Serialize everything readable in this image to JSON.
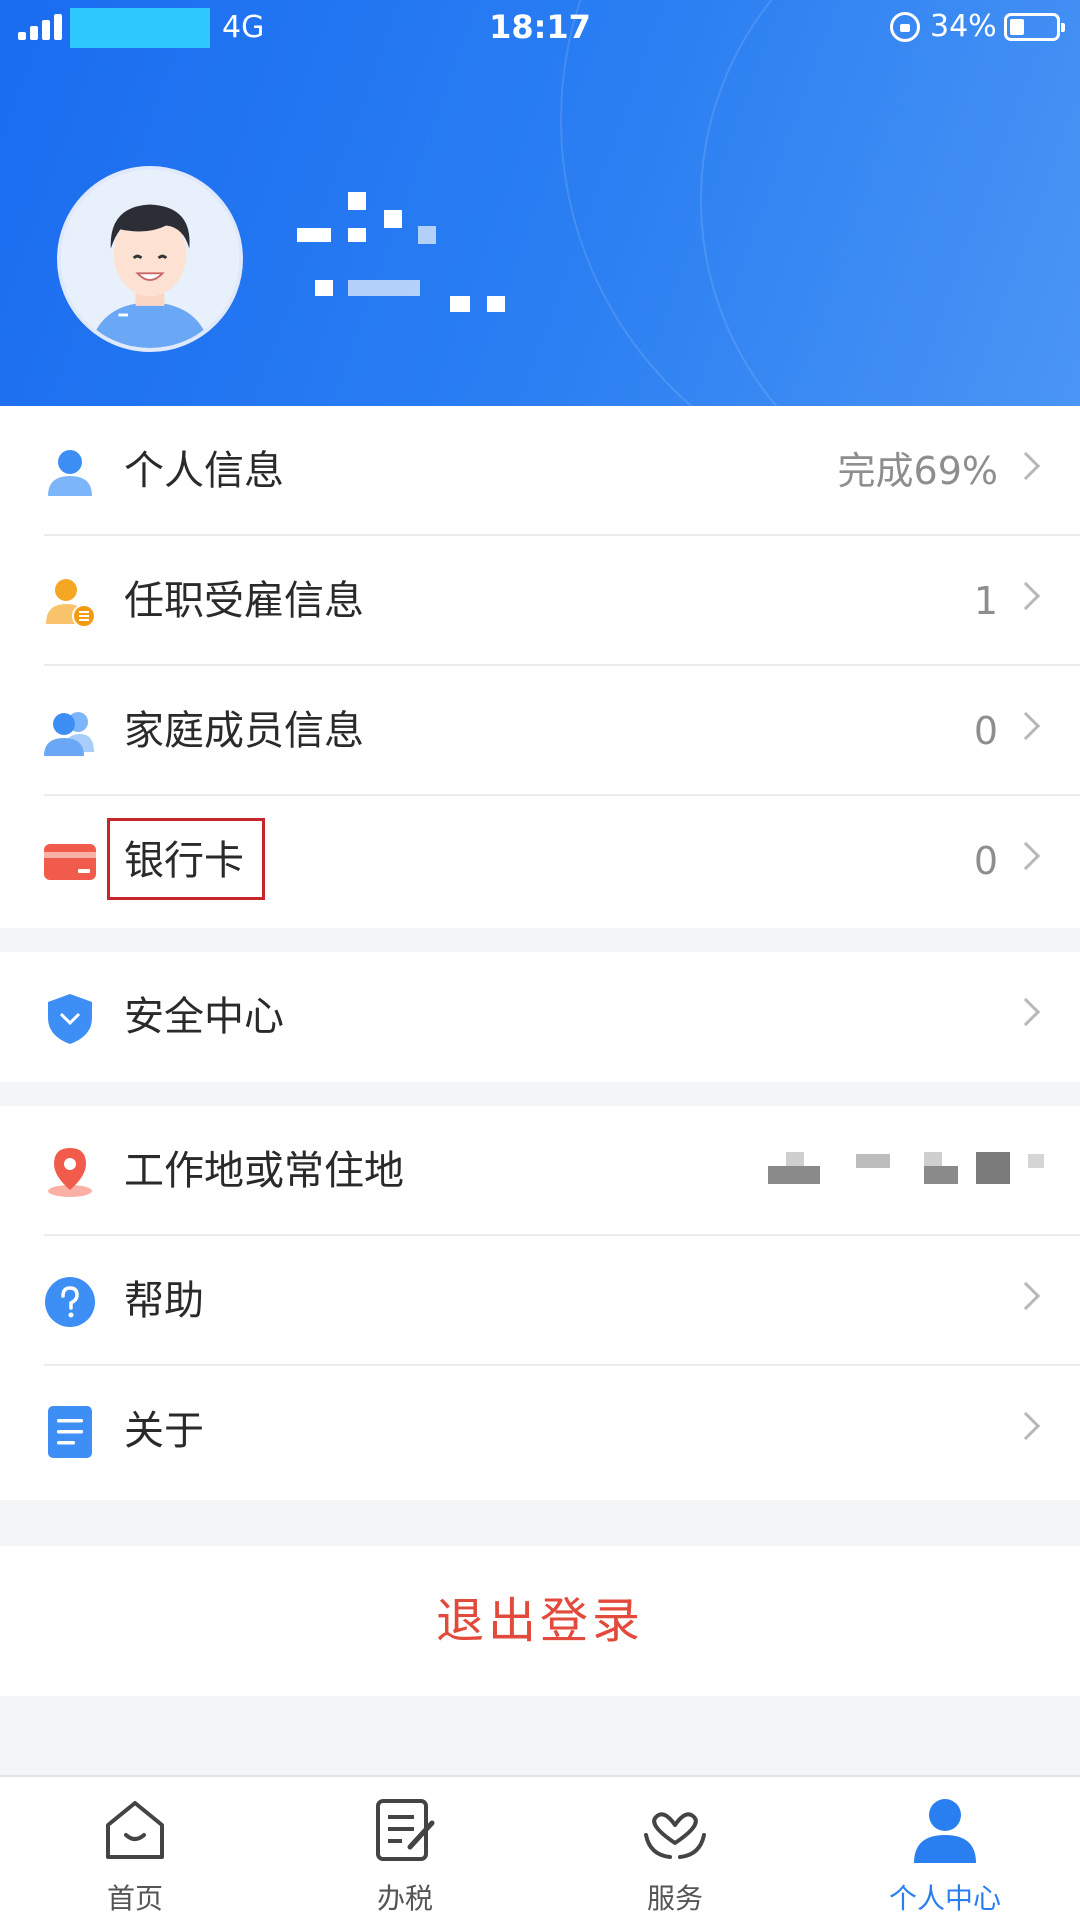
{
  "status_bar": {
    "network": "4G",
    "time": "18:17",
    "battery": "34%",
    "battery_level": 0.34
  },
  "menu_group_1": [
    {
      "key": "personal-info",
      "label": "个人信息",
      "value": "完成69%",
      "icon": "person-icon",
      "color": "#3d8ef5"
    },
    {
      "key": "employment-info",
      "label": "任职受雇信息",
      "value": "1",
      "icon": "employee-badge-icon",
      "color": "#f5a623"
    },
    {
      "key": "family-info",
      "label": "家庭成员信息",
      "value": "0",
      "icon": "family-icon",
      "color": "#3d8ef5"
    },
    {
      "key": "bank-card",
      "label": "银行卡",
      "value": "0",
      "icon": "bank-card-icon",
      "color": "#f05b4b"
    }
  ],
  "menu_group_2": [
    {
      "key": "security-center",
      "label": "安全中心",
      "value": "",
      "icon": "shield-icon",
      "color": "#3d8ef5"
    }
  ],
  "menu_group_3": [
    {
      "key": "work-location",
      "label": "工作地或常住地",
      "value": "",
      "icon": "location-pin-icon",
      "color": "#f05b4b"
    },
    {
      "key": "help",
      "label": "帮助",
      "value": "",
      "icon": "help-icon",
      "color": "#3d8ef5"
    },
    {
      "key": "about",
      "label": "关于",
      "value": "",
      "icon": "document-icon",
      "color": "#3d8ef5"
    }
  ],
  "logout_label": "退出登录",
  "tabs": [
    {
      "label": "首页",
      "icon": "home-icon",
      "active": false
    },
    {
      "label": "办税",
      "icon": "tax-form-icon",
      "active": false
    },
    {
      "label": "服务",
      "icon": "service-heart-icon",
      "active": false
    },
    {
      "label": "个人中心",
      "icon": "user-center-icon",
      "active": true
    }
  ],
  "colors": {
    "header_blue": "#1a6cf0",
    "accent": "#2a7ff0",
    "logout_red": "#e24a3b",
    "highlight_box": "#c9262b"
  }
}
